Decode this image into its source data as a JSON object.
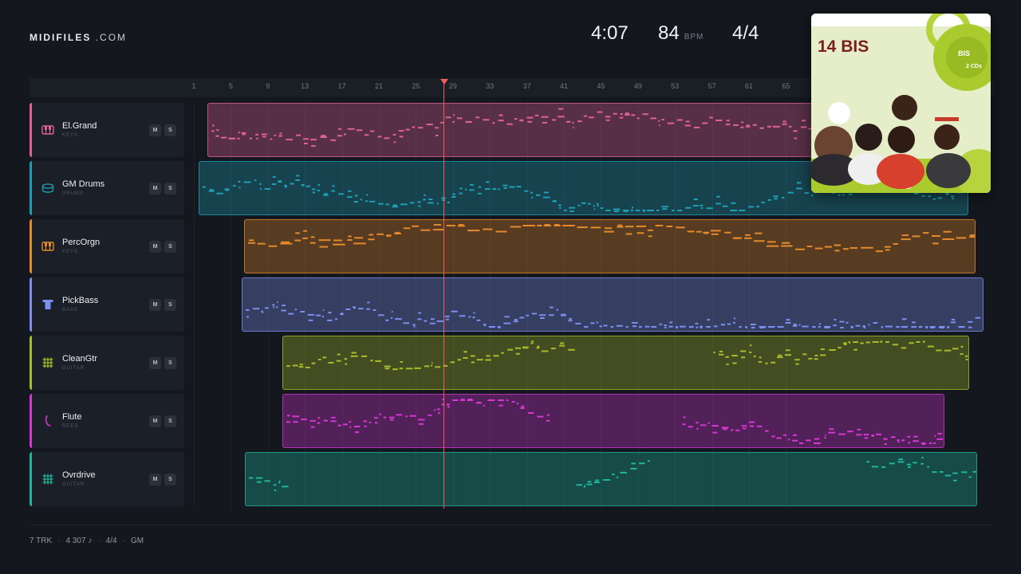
{
  "brand": {
    "name": "MIDIFILES",
    "domain": ".COM"
  },
  "stats": {
    "duration": "4:07",
    "bpm": "84",
    "bpm_unit": "BPM",
    "time_signature": "4/4"
  },
  "ruler": {
    "ticks": [
      "1",
      "5",
      "9",
      "13",
      "17",
      "21",
      "25",
      "29",
      "33",
      "37",
      "41",
      "45",
      "49",
      "53",
      "57",
      "61",
      "65"
    ]
  },
  "playhead": {
    "bar": 28
  },
  "tracks": [
    {
      "name": "El.Grand",
      "category": "KEYS",
      "icon": "piano-keys-icon",
      "color": "#e0609a",
      "mute": "M",
      "solo": "S"
    },
    {
      "name": "GM Drums",
      "category": "DRUMS",
      "icon": "drum-icon",
      "color": "#1f9fb6",
      "mute": "M",
      "solo": "S"
    },
    {
      "name": "PercOrgn",
      "category": "KEYS",
      "icon": "organ-keys-icon",
      "color": "#e48a2c",
      "mute": "M",
      "solo": "S"
    },
    {
      "name": "PickBass",
      "category": "BASS",
      "icon": "bass-icon",
      "color": "#7c8ff0",
      "mute": "M",
      "solo": "S"
    },
    {
      "name": "CleanGtr",
      "category": "GUITAR",
      "icon": "guitar-grid-icon",
      "color": "#a6bd2a",
      "mute": "M",
      "solo": "S"
    },
    {
      "name": "Flute",
      "category": "REED",
      "icon": "flute-icon",
      "color": "#d637d3",
      "mute": "M",
      "solo": "S"
    },
    {
      "name": "Ovrdrive",
      "category": "GUITAR",
      "icon": "guitar-grid-icon",
      "color": "#1fb59d",
      "mute": "M",
      "solo": "S"
    }
  ],
  "footer": {
    "tracks": "7 TRK",
    "notes": "4 307 ♪",
    "signature": "4/4",
    "standard": "GM"
  },
  "album": {
    "title": "14 BIS",
    "badge": "BIS",
    "subtitle": "2 CDs"
  }
}
